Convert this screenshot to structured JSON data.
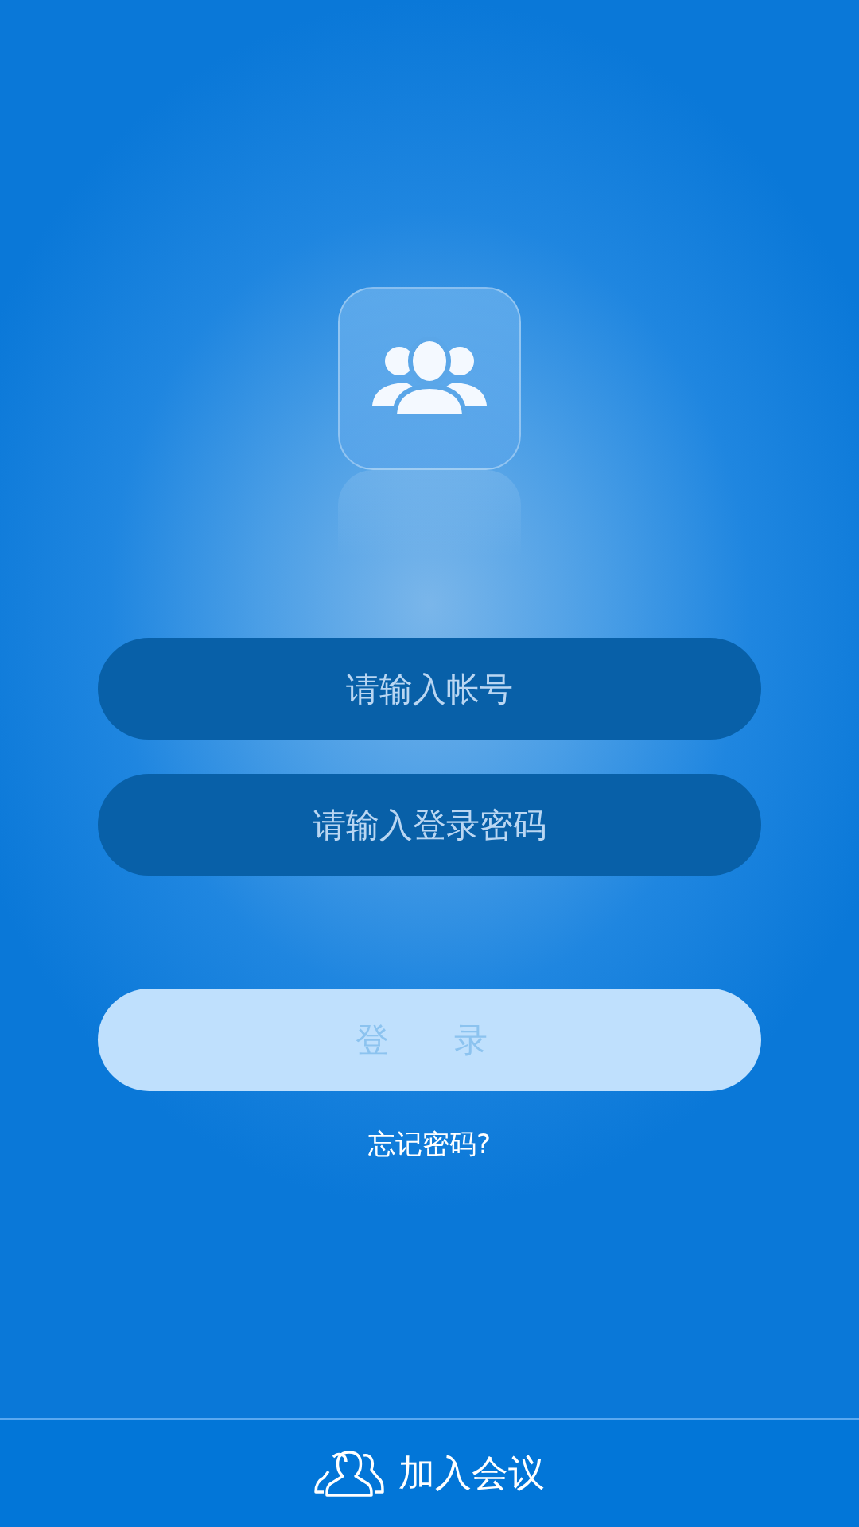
{
  "account_field": {
    "placeholder": "请输入帐号"
  },
  "password_field": {
    "placeholder": "请输入登录密码"
  },
  "login_button": {
    "label": "登　录",
    "disabled": true
  },
  "forgot_link": {
    "label": "忘记密码?"
  },
  "bottom_bar": {
    "label": "加入会议"
  }
}
